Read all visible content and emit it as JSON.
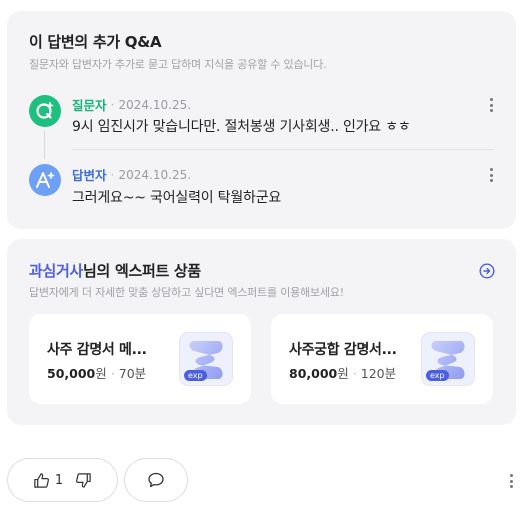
{
  "qa": {
    "title": "이 답변의 추가 Q&A",
    "subtitle": "질문자와 답변자가 추가로 묻고 답하며 지식을 공유할 수 있습니다.",
    "question": {
      "author": "질문자",
      "date": "2024.10.25.",
      "text": "9시 임진시가 맞습니다만. 절처봉생 기사회생.. 인가요 ㅎㅎ",
      "avatar_icon": "question-plus-icon",
      "avatar_color": "#1fbf7f"
    },
    "answer": {
      "author": "답변자",
      "date": "2024.10.25.",
      "text": "그러게요~~ 국어실력이 탁월하군요",
      "avatar_icon": "answer-plus-icon",
      "avatar_color": "#6ea0f5"
    }
  },
  "expert": {
    "name": "과심거사",
    "title_suffix": "님의 엑스퍼트 상품",
    "subtitle": "답변자에게 더 자세한 맞춤 상담하고 싶다면 엑스퍼트를 이용해보세요!",
    "go_icon": "arrow-circle-right-icon",
    "accent_color": "#4b5fe0",
    "products": [
      {
        "title": "사주 감명서 메...",
        "price": "50,000",
        "price_unit": "원",
        "duration": "70분",
        "badge": "exp"
      },
      {
        "title": "사주궁합 감명서...",
        "price": "80,000",
        "price_unit": "원",
        "duration": "120분",
        "badge": "exp"
      }
    ]
  },
  "actions": {
    "like_count": "1",
    "like_icon": "thumbs-up-icon",
    "dislike_icon": "thumbs-down-icon",
    "comment_icon": "comment-bubble-icon"
  }
}
